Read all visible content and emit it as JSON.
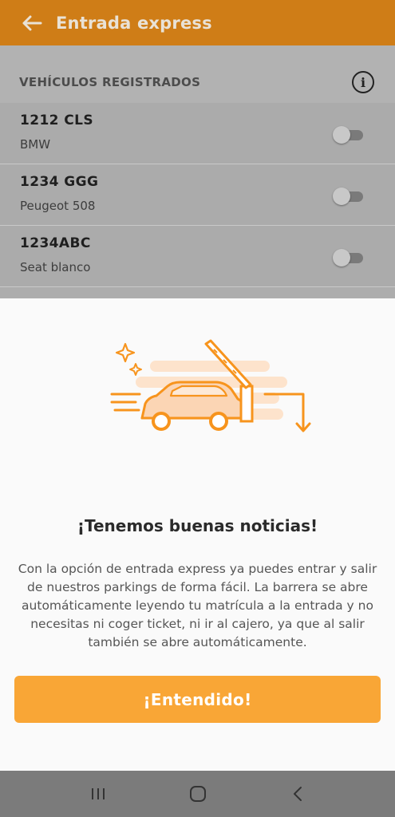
{
  "app_bar": {
    "title": "Entrada express",
    "back_icon": "arrow-left-icon"
  },
  "section": {
    "header": "VEHÍCULOS REGISTRADOS",
    "info_icon_glyph": "i"
  },
  "vehicles": [
    {
      "plate": "1212 CLS",
      "model": "BMW",
      "enabled": false
    },
    {
      "plate": "1234 GGG",
      "model": "Peugeot 508",
      "enabled": false
    },
    {
      "plate": "1234ABC",
      "model": "Seat blanco",
      "enabled": false
    }
  ],
  "sheet": {
    "title": "¡Tenemos buenas noticias!",
    "body": "Con la opción de entrada express ya puedes entrar y salir de nuestros parkings de forma fácil. La barrera se abre automáticamente leyendo tu matrícula a la entrada y no necesitas ni coger ticket, ni ir al cajero, ya que al salir también se abre automáticamente.",
    "button_label": "¡Entendido!",
    "illustration_icon": "car-barrier-entry-icon"
  },
  "colors": {
    "app_bar": "#cf7d17",
    "accent": "#f9a636",
    "illustration_orange": "#f7941d"
  },
  "system_nav": {
    "recent": "recent-apps-icon",
    "home": "home-icon",
    "back": "back-icon"
  }
}
